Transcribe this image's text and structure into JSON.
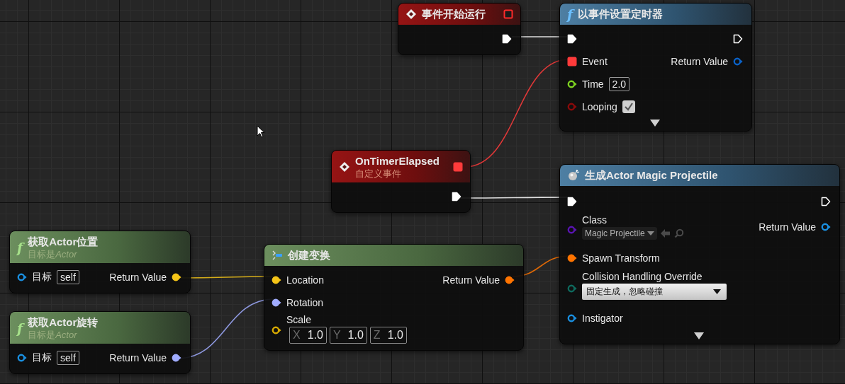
{
  "nodes": [
    {
      "kind": "event",
      "icon": {
        "kind": "diamond"
      },
      "title": "事件开始运行",
      "delegate": {
        "kind": "delegate",
        "color": "#ff2a2a",
        "connected": false
      },
      "rows": [
        {
          "right": {
            "kind": "exec",
            "color": "#ffffff",
            "connected": true
          }
        }
      ]
    },
    {
      "kind": "function",
      "icon": {
        "kind": "glyph",
        "text": "f"
      },
      "title": "以事件设置定时器",
      "expandable": true,
      "rows": [
        {
          "left": {
            "kind": "exec",
            "color": "#ffffff",
            "connected": true
          },
          "right": {
            "kind": "exec",
            "color": "#ffffff",
            "connected": false
          }
        },
        {
          "left": {
            "kind": "delegate",
            "color": "#ff3b3b",
            "connected": true,
            "label": "Event"
          },
          "right": {
            "kind": "data",
            "color": "#0a62c8",
            "connected": false,
            "label": "Return Value"
          }
        },
        {
          "left": {
            "kind": "data",
            "color": "#7ed321",
            "connected": false,
            "label": "Time",
            "widget": {
              "kind": "text",
              "value": "2.0"
            }
          }
        },
        {
          "left": {
            "kind": "data",
            "color": "#8a0a0a",
            "connected": false,
            "label": "Looping",
            "widget": {
              "kind": "checkbox",
              "checked": true
            }
          }
        }
      ]
    },
    {
      "kind": "event",
      "icon": {
        "kind": "diamond"
      },
      "title": "OnTimerElapsed",
      "subtitle": [
        {
          "text": "自定义事件",
          "italic": false
        }
      ],
      "delegate": {
        "kind": "delegate",
        "color": "#ff3b3b",
        "connected": true
      },
      "rows": [
        {
          "right": {
            "kind": "exec",
            "color": "#ffffff",
            "connected": true
          }
        }
      ]
    },
    {
      "kind": "function",
      "icon": {
        "kind": "bomb"
      },
      "title": "生成Actor Magic Projectile",
      "expandable": true,
      "rows": [
        {
          "left": {
            "kind": "exec",
            "color": "#ffffff",
            "connected": true
          },
          "right": {
            "kind": "exec",
            "color": "#ffffff",
            "connected": false
          }
        },
        {
          "left": {
            "kind": "data",
            "color": "#5a14b4",
            "connected": false,
            "label": "Class",
            "widget": {
              "kind": "class",
              "value": "Magic Projectile"
            }
          },
          "right": {
            "kind": "data",
            "color": "#1a8fe0",
            "connected": false,
            "label": "Return Value"
          }
        },
        {
          "left": {
            "kind": "data",
            "color": "#ff7400",
            "connected": true,
            "label": "Spawn Transform"
          }
        },
        {
          "left": {
            "kind": "data",
            "color": "#0e6a5e",
            "connected": false,
            "label": "Collision Handling Override",
            "widget": {
              "kind": "dropdown",
              "value": "固定生成，忽略碰撞"
            }
          }
        },
        {
          "left": {
            "kind": "data",
            "color": "#1a8fe0",
            "connected": false,
            "label": "Instigator"
          }
        }
      ]
    },
    {
      "kind": "pure",
      "icon": {
        "kind": "glyph",
        "text": "f"
      },
      "title": "获取Actor位置",
      "subtitle": [
        {
          "text": "目标是",
          "italic": false
        },
        {
          "text": "Actor",
          "italic": true
        }
      ],
      "rows": [
        {
          "left": {
            "kind": "data",
            "color": "#1a8fe0",
            "connected": false,
            "label": "目标",
            "widget": {
              "kind": "text",
              "value": "self"
            }
          },
          "right": {
            "kind": "data",
            "color": "#f5c518",
            "connected": true,
            "label": "Return Value"
          }
        }
      ]
    },
    {
      "kind": "pure",
      "icon": {
        "kind": "glyph",
        "text": "f"
      },
      "title": "获取Actor旋转",
      "subtitle": [
        {
          "text": "目标是",
          "italic": false
        },
        {
          "text": "Actor",
          "italic": true
        }
      ],
      "rows": [
        {
          "left": {
            "kind": "data",
            "color": "#1a8fe0",
            "connected": false,
            "label": "目标",
            "widget": {
              "kind": "text",
              "value": "self"
            }
          },
          "right": {
            "kind": "data",
            "color": "#a0acff",
            "connected": true,
            "label": "Return Value"
          }
        }
      ]
    },
    {
      "kind": "pure",
      "icon": {
        "kind": "make"
      },
      "title": "创建变换",
      "rows": [
        {
          "left": {
            "kind": "data",
            "color": "#f5c518",
            "connected": true,
            "label": "Location"
          },
          "right": {
            "kind": "data",
            "color": "#ff7400",
            "connected": true,
            "label": "Return Value"
          }
        },
        {
          "left": {
            "kind": "data",
            "color": "#a0acff",
            "connected": true,
            "label": "Rotation"
          }
        },
        {
          "left": {
            "kind": "data",
            "color": "#d8aa00",
            "connected": false,
            "label": "Scale",
            "widget": {
              "kind": "vector",
              "components": [
                {
                  "axis": "X",
                  "value": "1.0"
                },
                {
                  "axis": "Y",
                  "value": "1.0"
                },
                {
                  "axis": "Z",
                  "value": "1.0"
                }
              ]
            }
          }
        }
      ]
    }
  ]
}
